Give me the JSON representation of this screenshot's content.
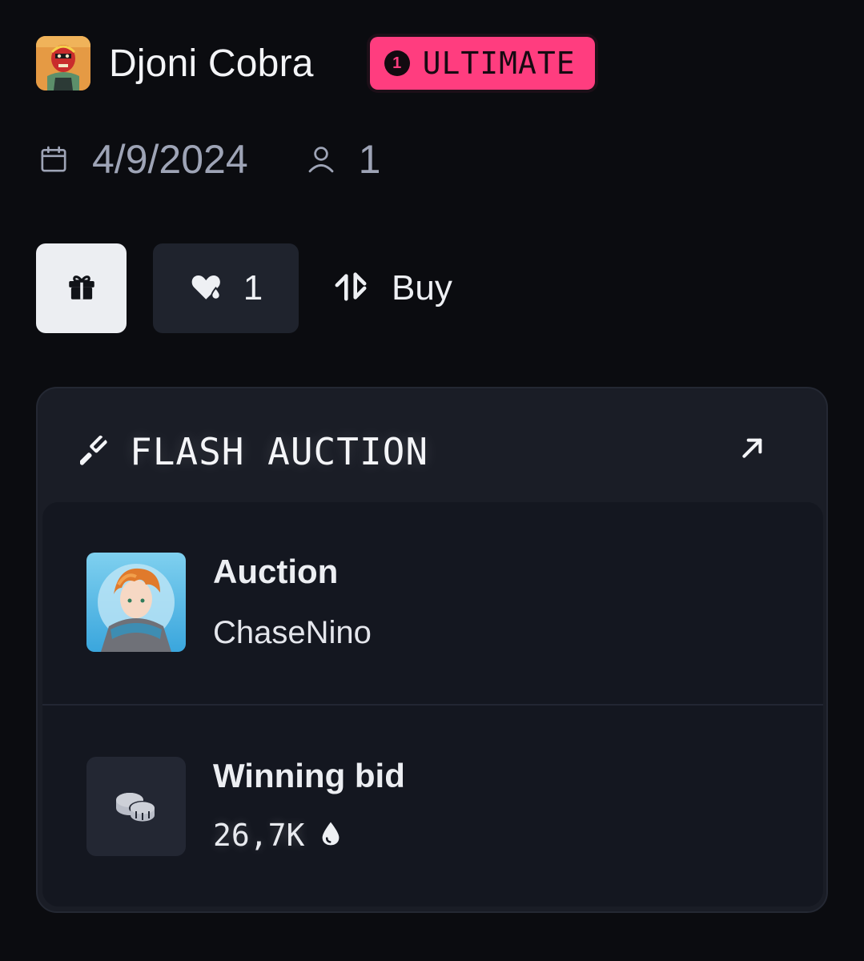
{
  "header": {
    "owner_name": "Djoni Cobra",
    "tier_number": "1",
    "tier_label": "ULTIMATE",
    "tier_color": "#ff3d7f"
  },
  "meta": {
    "date": "4/9/2024",
    "holders": "1",
    "date_icon": "calendar-icon",
    "holders_icon": "user-icon"
  },
  "actions": {
    "gift_icon": "gift-icon",
    "like_count": "1",
    "like_icon": "heart-drop-icon",
    "buy_label": "Buy",
    "buy_icon": "trade-arrows-icon"
  },
  "auction": {
    "title": "FLASH AUCTION",
    "title_icon": "gavel-icon",
    "link_icon": "arrow-up-right-icon",
    "seller_heading": "Auction",
    "seller_name": "ChaseNino",
    "bid_heading": "Winning bid",
    "bid_value": "26,7K",
    "bid_icon": "coins-icon",
    "currency_icon": "drop-icon"
  }
}
